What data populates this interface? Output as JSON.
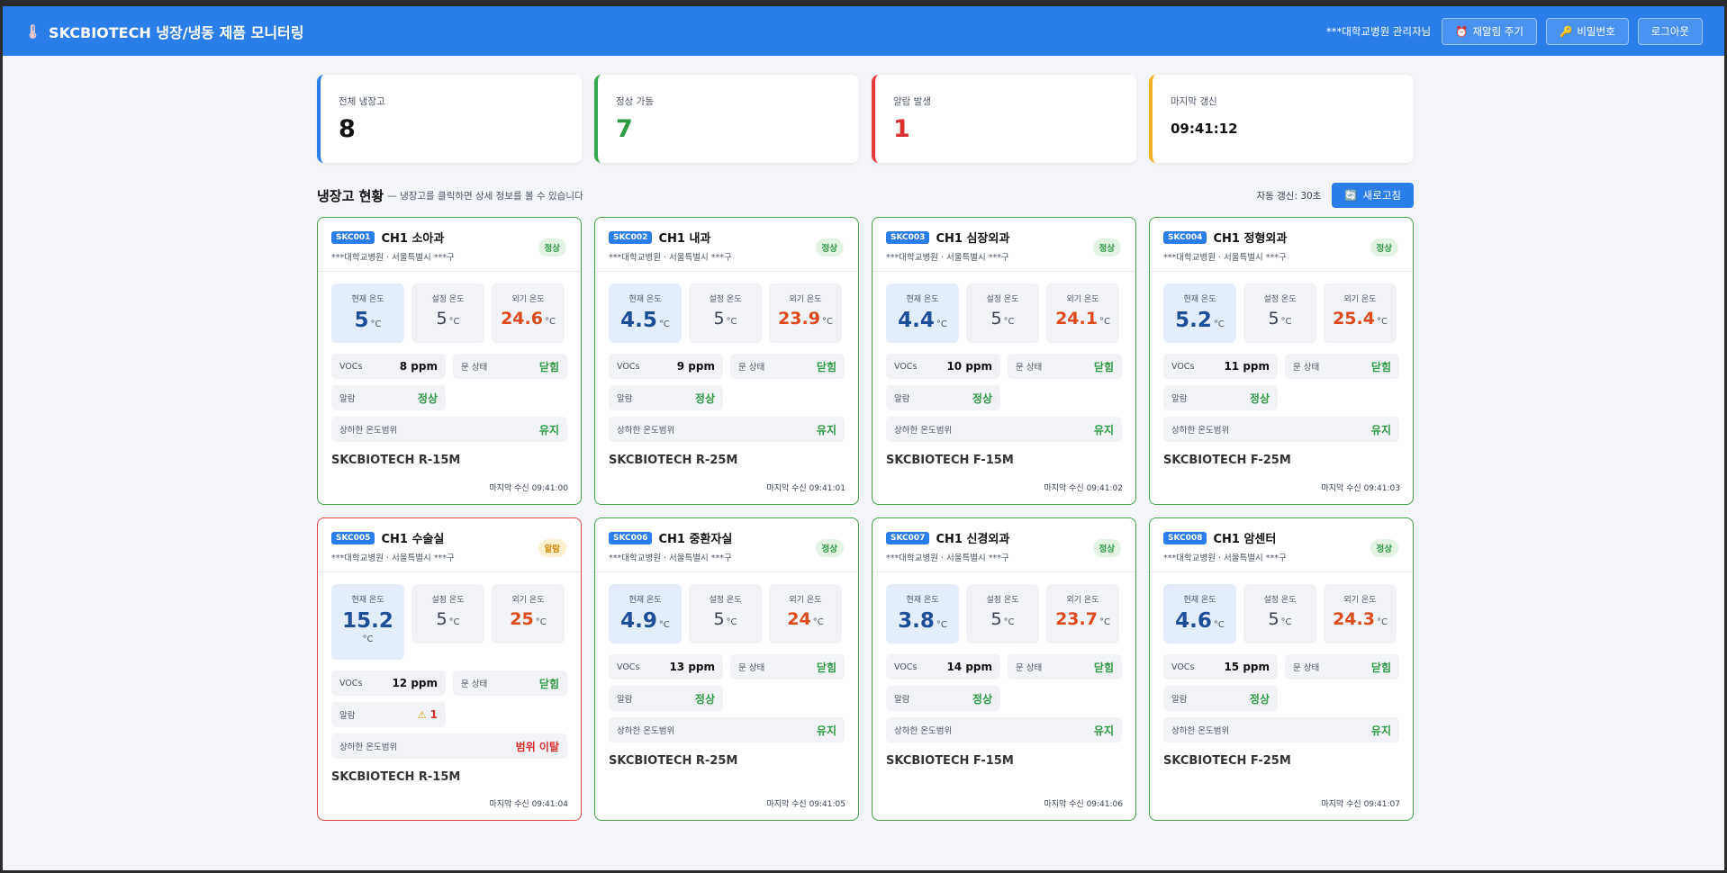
{
  "header": {
    "title": "SKCBIOTECH 냉장/냉동 제품 모니터링",
    "user": "***대학교병원 관리자님",
    "realarm_label": "재알림 주기",
    "password_label": "비밀번호",
    "logout_label": "로그아웃"
  },
  "stats": {
    "total_label": "전체 냉장고",
    "total_value": "8",
    "ok_label": "정상 가동",
    "ok_value": "7",
    "alarm_label": "알람 발생",
    "alarm_value": "1",
    "updated_label": "마지막 갱신",
    "updated_value": "09:41:12"
  },
  "section": {
    "title": "냉장고 현황",
    "subtitle": "— 냉장고를 클릭하면 상세 정보를 볼 수 있습니다",
    "auto_refresh": "자동 갱신: 30초",
    "refresh_label": "새로고침"
  },
  "labels": {
    "current_temp": "현재 온도",
    "set_temp": "설정 온도",
    "ext_temp": "외기 온도",
    "unit": "°C",
    "vocs": "VOCs",
    "door": "문 상태",
    "alarm": "알람",
    "range": "상하한 온도범위"
  },
  "fridges": [
    {
      "code": "SKC001",
      "name": "CH1 소아과",
      "hospital": "***대학교병원 · 서울특별시 ***구",
      "status": "정상",
      "current": "5",
      "set": "5",
      "ext": "24.6",
      "vocs": "8 ppm",
      "door": "닫힘",
      "alarm": "정상",
      "range": "유지",
      "model": "SKCBIOTECH R-15M",
      "last": "마지막 수신 09:41:00"
    },
    {
      "code": "SKC002",
      "name": "CH1 내과",
      "hospital": "***대학교병원 · 서울특별시 ***구",
      "status": "정상",
      "current": "4.5",
      "set": "5",
      "ext": "23.9",
      "vocs": "9 ppm",
      "door": "닫힘",
      "alarm": "정상",
      "range": "유지",
      "model": "SKCBIOTECH R-25M",
      "last": "마지막 수신 09:41:01"
    },
    {
      "code": "SKC003",
      "name": "CH1 심장외과",
      "hospital": "***대학교병원 · 서울특별시 ***구",
      "status": "정상",
      "current": "4.4",
      "set": "5",
      "ext": "24.1",
      "vocs": "10 ppm",
      "door": "닫힘",
      "alarm": "정상",
      "range": "유지",
      "model": "SKCBIOTECH F-15M",
      "last": "마지막 수신 09:41:02"
    },
    {
      "code": "SKC004",
      "name": "CH1 정형외과",
      "hospital": "***대학교병원 · 서울특별시 ***구",
      "status": "정상",
      "current": "5.2",
      "set": "5",
      "ext": "25.4",
      "vocs": "11 ppm",
      "door": "닫힘",
      "alarm": "정상",
      "range": "유지",
      "model": "SKCBIOTECH F-25M",
      "last": "마지막 수신 09:41:03"
    },
    {
      "code": "SKC005",
      "name": "CH1 수술실",
      "hospital": "***대학교병원 · 서울특별시 ***구",
      "status": "알람",
      "current": "15.2",
      "set": "5",
      "ext": "25",
      "vocs": "12 ppm",
      "door": "닫힘",
      "alarm": "1",
      "range": "범위 이탈",
      "model": "SKCBIOTECH R-15M",
      "last": "마지막 수신 09:41:04"
    },
    {
      "code": "SKC006",
      "name": "CH1 중환자실",
      "hospital": "***대학교병원 · 서울특별시 ***구",
      "status": "정상",
      "current": "4.9",
      "set": "5",
      "ext": "24",
      "vocs": "13 ppm",
      "door": "닫힘",
      "alarm": "정상",
      "range": "유지",
      "model": "SKCBIOTECH R-25M",
      "last": "마지막 수신 09:41:05"
    },
    {
      "code": "SKC007",
      "name": "CH1 신경외과",
      "hospital": "***대학교병원 · 서울특별시 ***구",
      "status": "정상",
      "current": "3.8",
      "set": "5",
      "ext": "23.7",
      "vocs": "14 ppm",
      "door": "닫힘",
      "alarm": "정상",
      "range": "유지",
      "model": "SKCBIOTECH F-15M",
      "last": "마지막 수신 09:41:06"
    },
    {
      "code": "SKC008",
      "name": "CH1 암센터",
      "hospital": "***대학교병원 · 서울특별시 ***구",
      "status": "정상",
      "current": "4.6",
      "set": "5",
      "ext": "24.3",
      "vocs": "15 ppm",
      "door": "닫힘",
      "alarm": "정상",
      "range": "유지",
      "model": "SKCBIOTECH F-25M",
      "last": "마지막 수신 09:41:07"
    }
  ],
  "colors": {
    "primary": "#2b7de9",
    "ok": "#2e9a45",
    "alarm": "#d93030",
    "warn": "#d08a0c"
  }
}
